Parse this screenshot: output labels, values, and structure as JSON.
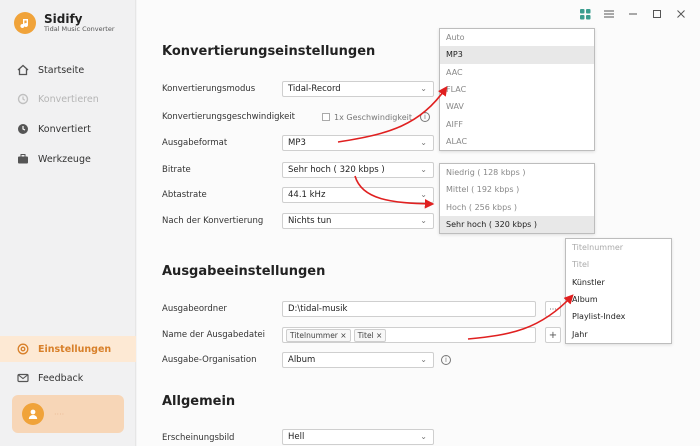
{
  "app": {
    "name": "Sidify",
    "subtitle": "Tidal Music Converter"
  },
  "sidebar": {
    "items": [
      {
        "label": "Startseite",
        "icon": "home-icon",
        "state": "normal"
      },
      {
        "label": "Konvertieren",
        "icon": "refresh-icon",
        "state": "disabled"
      },
      {
        "label": "Konvertiert",
        "icon": "clock-icon",
        "state": "normal"
      },
      {
        "label": "Werkzeuge",
        "icon": "toolbox-icon",
        "state": "normal"
      },
      {
        "label": "Einstellungen",
        "icon": "settings-icon",
        "state": "active"
      },
      {
        "label": "Feedback",
        "icon": "mail-icon",
        "state": "normal"
      }
    ],
    "user": {
      "name": "····"
    }
  },
  "main": {
    "conversion_title": "Konvertierungseinstellungen",
    "rows": {
      "mode": {
        "label": "Konvertierungsmodus",
        "value": "Tidal-Record"
      },
      "speed": {
        "label": "Konvertierungsgeschwindigkeit",
        "option": "1x Geschwindigkeit"
      },
      "format": {
        "label": "Ausgabeformat",
        "value": "MP3"
      },
      "bitrate": {
        "label": "Bitrate",
        "value": "Sehr hoch ( 320 kbps )"
      },
      "samplerate": {
        "label": "Abtastrate",
        "value": "44.1 kHz"
      },
      "after": {
        "label": "Nach der Konvertierung",
        "value": "Nichts tun"
      }
    },
    "output_title": "Ausgabeeinstellungen",
    "output": {
      "folder": {
        "label": "Ausgabeordner",
        "value": "D:\\tidal-musik",
        "button": "···"
      },
      "filename": {
        "label": "Name der Ausgabedatei",
        "tags": [
          "Titelnummer ×",
          "Titel ×"
        ],
        "button": "+"
      },
      "organisation": {
        "label": "Ausgabe-Organisation",
        "value": "Album"
      }
    },
    "general_title": "Allgemein",
    "general": {
      "appearance": {
        "label": "Erscheinungsbild",
        "value": "Hell"
      }
    }
  },
  "format_dropdown": {
    "options": [
      "Auto",
      "MP3",
      "AAC",
      "FLAC",
      "WAV",
      "AIFF",
      "ALAC"
    ],
    "selected": "MP3"
  },
  "bitrate_dropdown": {
    "options": [
      "Niedrig ( 128 kbps )",
      "Mittel ( 192 kbps )",
      "Hoch ( 256 kbps )",
      "Sehr hoch ( 320 kbps )"
    ],
    "selected": "Sehr hoch ( 320 kbps )"
  },
  "filename_dropdown": {
    "options": [
      "Titelnummer",
      "Titel",
      "Künstler",
      "Album",
      "Playlist-Index",
      "Jahr"
    ],
    "disabled": [
      "Titelnummer",
      "Titel"
    ]
  },
  "colors": {
    "accent": "#f0a33a",
    "active_bg": "#fde9d4",
    "arrow": "#e02020"
  }
}
